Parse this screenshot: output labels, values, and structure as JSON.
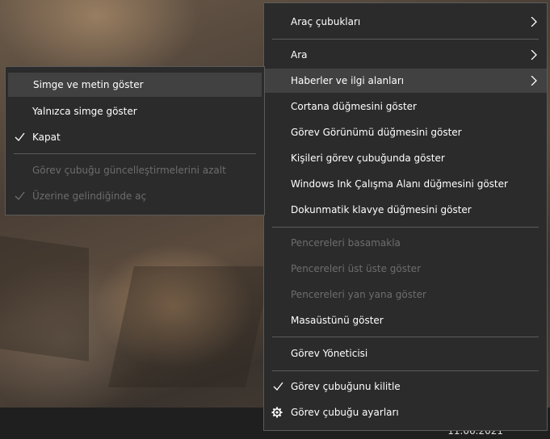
{
  "main_menu": {
    "toolbars": "Araç çubukları",
    "search": "Ara",
    "news": "Haberler ve ilgi alanları",
    "cortana": "Cortana düğmesini göster",
    "task_view": "Görev Görünümü düğmesini göster",
    "people": "Kişileri görev çubuğunda göster",
    "ink": "Windows Ink Çalışma Alanı düğmesini göster",
    "keyboard": "Dokunmatik klavye düğmesini göster",
    "cascade": "Pencereleri basamakla",
    "stacked": "Pencereleri üst üste göster",
    "side_by_side": "Pencereleri yan yana göster",
    "show_desktop": "Masaüstünü göster",
    "task_manager": "Görev Yöneticisi",
    "lock_taskbar": "Görev çubuğunu kilitle",
    "taskbar_settings": "Görev çubuğu ayarları"
  },
  "sub_menu": {
    "icon_and_text": "Simge ve metin göster",
    "icon_only": "Yalnızca simge göster",
    "turn_off": "Kapat",
    "reduce_updates": "Görev çubuğu güncelleştirmelerini azalt",
    "open_on_hover": "Üzerine gelindiğinde aç"
  },
  "icons": {
    "chevron": "chevron-right-icon",
    "check": "checkmark-icon",
    "gear": "gear-icon"
  },
  "colors": {
    "menu_bg": "#2b2b2b",
    "highlight": "#414141",
    "disabled_text": "#6d6d6d",
    "taskbar": "#1f1f1f"
  }
}
